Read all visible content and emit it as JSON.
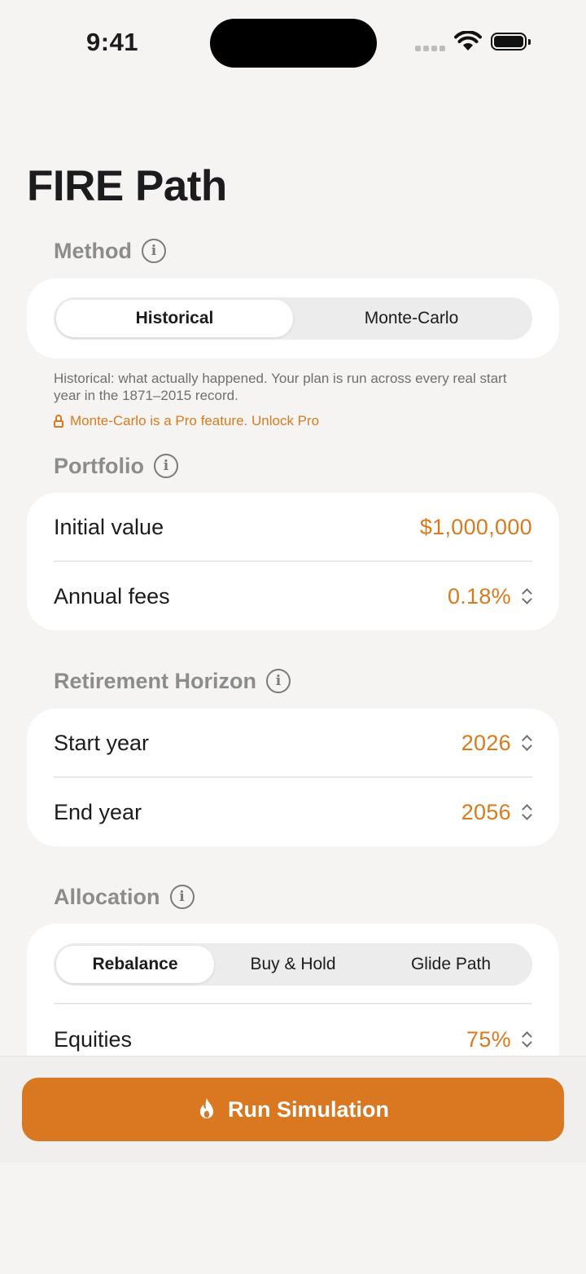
{
  "status_bar": {
    "time": "9:41"
  },
  "title": "FIRE Path",
  "method": {
    "header": "Method",
    "options": [
      "Historical",
      "Monte-Carlo"
    ],
    "selected": "Historical",
    "helper": "Historical: what actually happened. Your plan is run across every real start year in the 1871–2015 record.",
    "pro_notice": "Monte-Carlo is a Pro feature. Unlock Pro"
  },
  "portfolio": {
    "header": "Portfolio",
    "rows": [
      {
        "label": "Initial value",
        "value": "$1,000,000"
      },
      {
        "label": "Annual fees",
        "value": "0.18%"
      }
    ]
  },
  "horizon": {
    "header": "Retirement Horizon",
    "rows": [
      {
        "label": "Start year",
        "value": "2026"
      },
      {
        "label": "End year",
        "value": "2056"
      }
    ]
  },
  "allocation": {
    "header": "Allocation",
    "options": [
      "Rebalance",
      "Buy & Hold",
      "Glide Path"
    ],
    "selected": "Rebalance",
    "rows": [
      {
        "label": "Equities",
        "value": "75%"
      }
    ]
  },
  "run_button": {
    "label": "Run Simulation"
  },
  "colors": {
    "accent": "#d97821",
    "background": "#f5f4f2",
    "card": "#ffffff"
  },
  "icons": [
    "info-icon",
    "lock-icon",
    "stepper-icon",
    "flame-icon",
    "wifi-icon",
    "battery-icon"
  ]
}
